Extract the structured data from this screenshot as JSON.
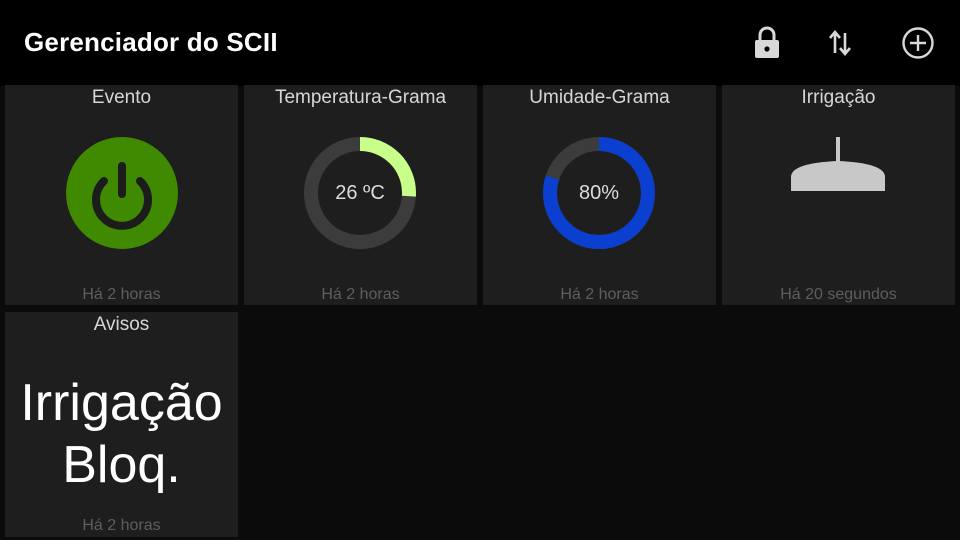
{
  "app": {
    "title": "Gerenciador do SCII",
    "actions": [
      "lock-icon",
      "swap-vert-icon",
      "add-circle-icon"
    ]
  },
  "tiles": {
    "evento": {
      "title": "Evento",
      "icon": "power-icon",
      "state_color": "#3f8a00",
      "footer": "Há 2 horas"
    },
    "temperatura": {
      "title": "Temperatura-Grama",
      "value_text": "26 ºC",
      "gauge_fraction": 0.26,
      "gauge_color": "#c8ff8a",
      "track_color": "#3c3c3c",
      "footer": "Há 2 horas"
    },
    "umidade": {
      "title": "Umidade-Grama",
      "value_text": "80%",
      "gauge_fraction": 0.8,
      "gauge_color": "#0a3fd0",
      "track_color": "#3c3c3c",
      "footer": "Há 2 horas"
    },
    "irrigacao": {
      "title": "Irrigação",
      "icon": "lamp-icon",
      "icon_color": "#c8c8c8",
      "footer": "Há 20 segundos"
    },
    "avisos": {
      "title": "Avisos",
      "message": "Irrigação Bloq.",
      "footer": "Há 2 horas"
    }
  }
}
